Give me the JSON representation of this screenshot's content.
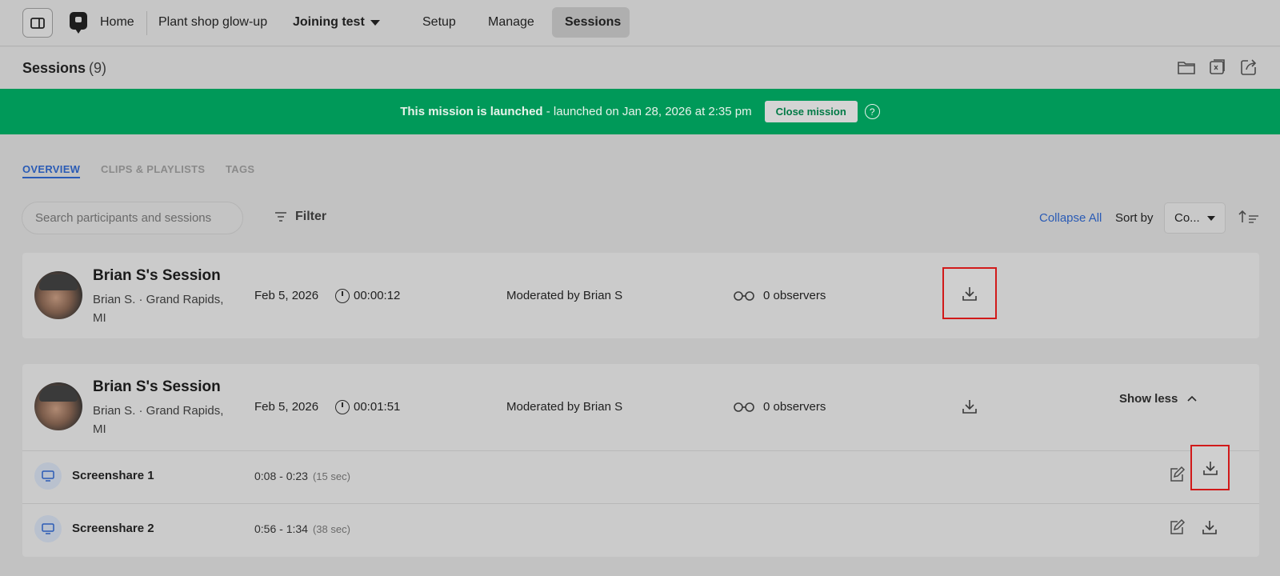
{
  "nav": {
    "home": "Home",
    "project": "Plant shop glow-up",
    "test": "Joining test",
    "tabs": [
      {
        "label": "Setup"
      },
      {
        "label": "Manage"
      },
      {
        "label": "Sessions"
      }
    ]
  },
  "page": {
    "title": "Sessions",
    "count": "(9)"
  },
  "banner": {
    "strong": "This mission is launched",
    "rest": " - launched on Jan 28, 2026 at 2:35 pm",
    "button": "Close mission",
    "help": "?"
  },
  "subtabs": [
    "OVERVIEW",
    "CLIPS & PLAYLISTS",
    "TAGS"
  ],
  "toolbar": {
    "search_placeholder": "Search participants and sessions",
    "filter": "Filter",
    "collapse_all": "Collapse All",
    "sort_by": "Sort by",
    "sort_value": "Co..."
  },
  "sessions": [
    {
      "name": "Brian S's Session",
      "location": "Brian S. · Grand Rapids, MI",
      "date": "Feb 5, 2026",
      "duration": "00:00:12",
      "moderator": "Moderated by Brian S",
      "observers": "0 observers"
    },
    {
      "name": "Brian S's Session",
      "location": "Brian S. · Grand Rapids, MI",
      "date": "Feb 5, 2026",
      "duration": "00:01:51",
      "moderator": "Moderated by Brian S",
      "observers": "0 observers",
      "toggle": "Show less",
      "clips": [
        {
          "name": "Screenshare 1",
          "range": "0:08 - 0:23",
          "length": "(15 sec)"
        },
        {
          "name": "Screenshare 2",
          "range": "0:56 - 1:34",
          "length": "(38 sec)"
        }
      ]
    }
  ],
  "colors": {
    "banner": "#009959",
    "accent": "#2a5bb5",
    "highlight": "#d11a1a"
  }
}
